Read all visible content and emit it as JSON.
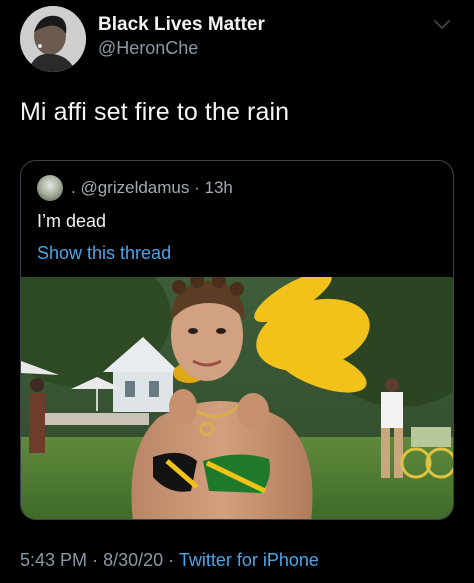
{
  "author": {
    "display_name": "Black Lives Matter",
    "handle": "@HeronChe",
    "avatar_icon": "profile-photo-avatar"
  },
  "tweet": {
    "text": "Mi affi set fire to the rain"
  },
  "quoted_tweet": {
    "avatar_icon": "profile-photo-avatar",
    "separator": ".",
    "handle": "@grizeldamus",
    "dot": "·",
    "time": "13h",
    "text": "I’m dead",
    "show_thread_label": "Show this thread",
    "image_icon": "photo-woman-carnival-costume"
  },
  "footer": {
    "time": "5:43 PM",
    "dot1": "·",
    "date": "8/30/20",
    "dot2": "·",
    "source": "Twitter for iPhone"
  },
  "colors": {
    "background": "#000000",
    "secondary_text": "#8899a6",
    "link": "#4aa6e8",
    "border": "#3d4248"
  },
  "icons": {
    "menu": "chevron-down-icon"
  }
}
